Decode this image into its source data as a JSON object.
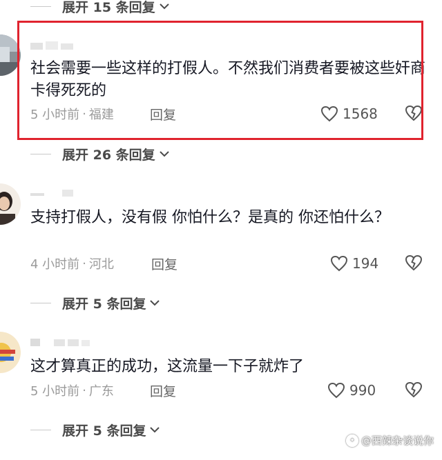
{
  "expand_links": [
    {
      "label": "展开 15 条回复"
    },
    {
      "label": "展开 26 条回复"
    },
    {
      "label": "展开 5 条回复"
    },
    {
      "label": "展开 5 条回复"
    }
  ],
  "comments": [
    {
      "text": "社会需要一些这样的打假人。不然我们消费者要被这些奸商卡得死死的",
      "time": "5 小时前",
      "location": "福建",
      "reply_label": "回复",
      "likes": "1568"
    },
    {
      "text": "支持打假人，没有假  你怕什么？是真的  你还怕什么？",
      "time": "4 小时前",
      "location": "河北",
      "reply_label": "回复",
      "likes": "194"
    },
    {
      "text": "这才算真正的成功，这流量一下子就炸了",
      "time": "5 小时前",
      "location": "广东",
      "reply_label": "回复",
      "likes": "990"
    }
  ],
  "meta_separator": "·",
  "watermark": "@西辣杂谈说你",
  "colors": {
    "highlight_border": "#e0232e",
    "text": "#161823",
    "meta": "#9a9a9a"
  }
}
